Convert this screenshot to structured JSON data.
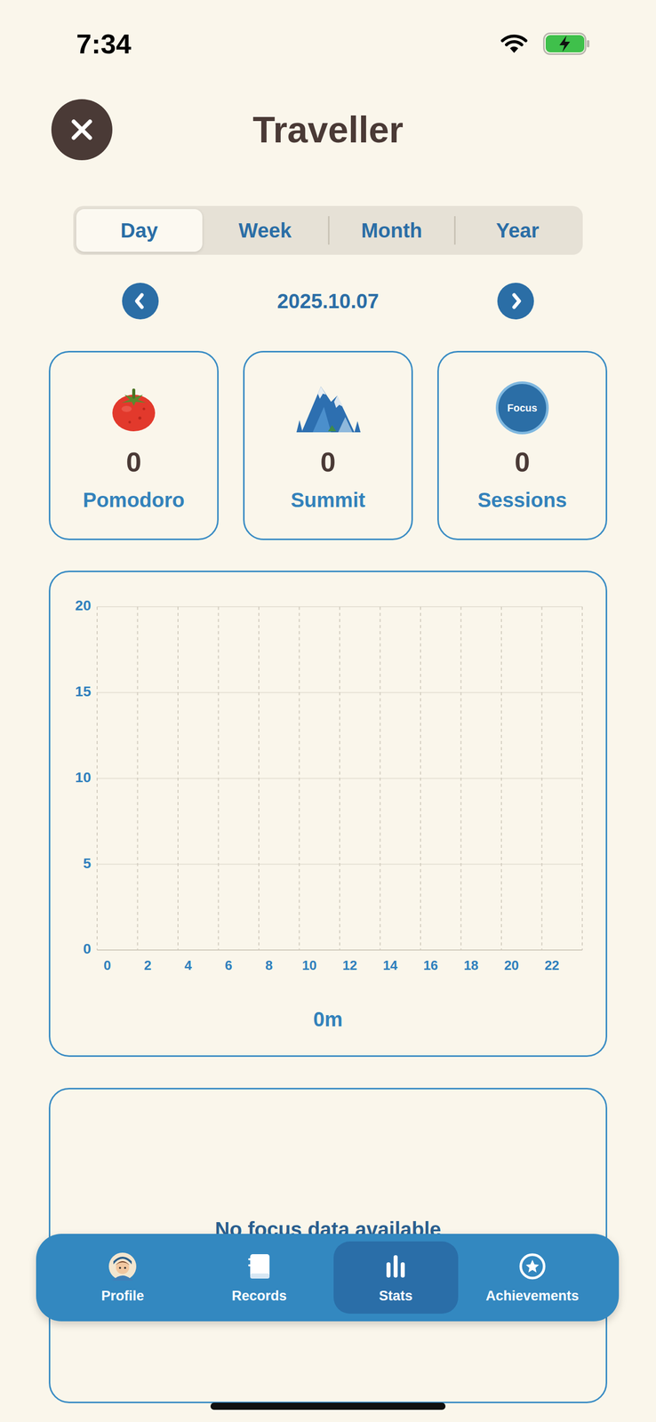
{
  "status_bar": {
    "time": "7:34",
    "wifi": true,
    "battery": {
      "level": 1,
      "charging": true
    }
  },
  "header": {
    "title": "Traveller"
  },
  "tabs": [
    {
      "label": "Day",
      "selected": true
    },
    {
      "label": "Week",
      "selected": false
    },
    {
      "label": "Month",
      "selected": false
    },
    {
      "label": "Year",
      "selected": false
    }
  ],
  "date_nav": {
    "date": "2025.10.07"
  },
  "stats": [
    {
      "label": "Pomodoro",
      "value": "0",
      "kind": "tomato"
    },
    {
      "label": "Summit",
      "value": "0",
      "kind": "mountain"
    },
    {
      "label": "Sessions",
      "value": "0",
      "kind": "badge",
      "badge": "Focus"
    }
  ],
  "chart": {
    "y_ticks": [
      "0",
      "5",
      "10",
      "15",
      "20"
    ],
    "x_ticks": [
      "0",
      "2",
      "4",
      "6",
      "8",
      "10",
      "12",
      "14",
      "16",
      "18",
      "20",
      "22"
    ],
    "series": [
      {
        "values": [
          0,
          0,
          0,
          0,
          0,
          0,
          0,
          0,
          0,
          0,
          0,
          0,
          0,
          0,
          0,
          0,
          0,
          0,
          0,
          0,
          0,
          0,
          0,
          0
        ]
      }
    ],
    "total": "0m"
  },
  "focus_panel": {
    "message": "No focus data available"
  },
  "nav": [
    {
      "label": "Profile",
      "selected": false,
      "kind": "profile"
    },
    {
      "label": "Records",
      "selected": false,
      "kind": "records"
    },
    {
      "label": "Stats",
      "selected": true,
      "kind": "stats"
    },
    {
      "label": "Achievements",
      "selected": false,
      "kind": "achievements"
    }
  ]
}
